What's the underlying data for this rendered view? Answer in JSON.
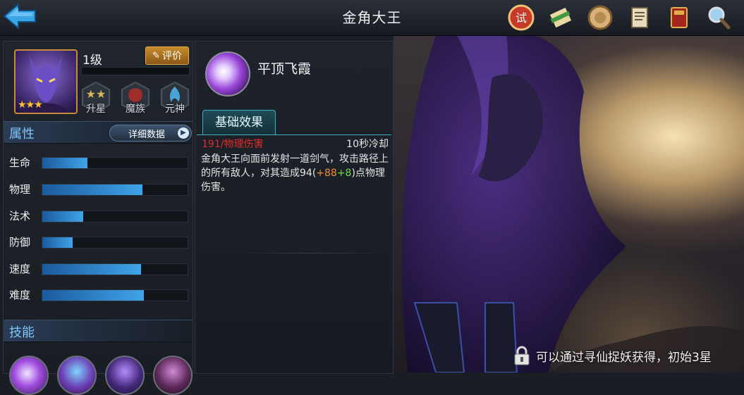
{
  "header": {
    "title": "金角大王"
  },
  "top_icons": [
    "trial-seal-icon",
    "scroll-icon",
    "medal-icon",
    "notes-icon",
    "book-icon",
    "magnifier-icon"
  ],
  "hero": {
    "level": "1级",
    "stars": "★★★",
    "rate_label": "评价",
    "badges": [
      {
        "label": "升星",
        "icon": "star-upgrade-icon"
      },
      {
        "label": "魔族",
        "icon": "demon-clan-icon"
      },
      {
        "label": "元神",
        "icon": "spirit-flame-icon"
      }
    ]
  },
  "attributes": {
    "title": "属性",
    "detail_button": "详细数据",
    "stats": [
      {
        "name": "生命",
        "value": 0.31
      },
      {
        "name": "物理",
        "value": 0.69
      },
      {
        "name": "法术",
        "value": 0.28
      },
      {
        "name": "防御",
        "value": 0.21
      },
      {
        "name": "速度",
        "value": 0.68
      },
      {
        "name": "难度",
        "value": 0.7
      }
    ]
  },
  "skills": {
    "title": "技能",
    "icons": [
      "skill-slash-icon",
      "skill-gourd-icon",
      "skill-summon-icon",
      "skill-shadow-icon"
    ]
  },
  "skill_detail": {
    "name": "平顶飞霞",
    "tab": "基础效果",
    "damage_type": "191/物理伤害",
    "cooldown": "10秒冷却",
    "desc_prefix": "金角大王向面前发射一道剑气，攻击路径上的所有敌人，对其造成94(",
    "desc_bonus1": "+88",
    "desc_bonus2": "+8",
    "desc_suffix": ")点物理伤害。"
  },
  "footer": {
    "unlock_text": "可以通过寻仙捉妖获得，初始3星"
  },
  "colors": {
    "accent_blue": "#41a4e8",
    "damage_red": "#e22b2b",
    "bonus_orange": "#f08c3c",
    "bonus_green": "#6fdc4a",
    "gold": "#c98a3b"
  }
}
